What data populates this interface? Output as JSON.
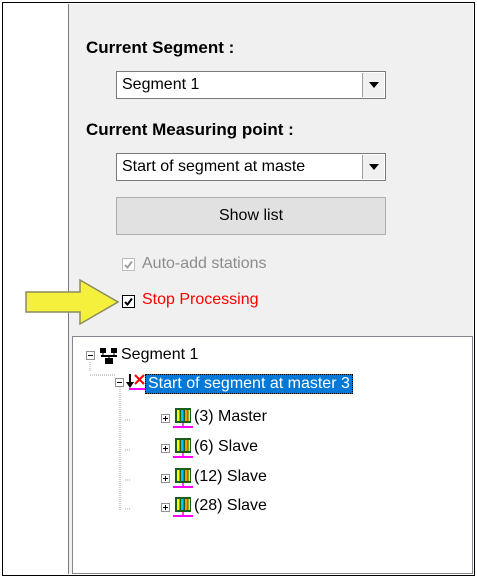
{
  "segment": {
    "label": "Current Segment :",
    "selected": "Segment 1"
  },
  "measuring_point": {
    "label": "Current Measuring point :",
    "selected": "Start of segment at maste"
  },
  "show_list_button": "Show list",
  "auto_add": {
    "label": "Auto-add stations",
    "checked": true,
    "disabled": true
  },
  "stop_processing": {
    "label": "Stop Processing",
    "checked": true,
    "color": "#ff0000"
  },
  "arrow_color": "#f5f03c",
  "tree": {
    "root": "Segment 1",
    "child": "Start of segment at master 3",
    "stations": [
      {
        "label": "(3) Master"
      },
      {
        "label": "(6) Slave"
      },
      {
        "label": "(12) Slave"
      },
      {
        "label": "(28) Slave"
      }
    ]
  }
}
